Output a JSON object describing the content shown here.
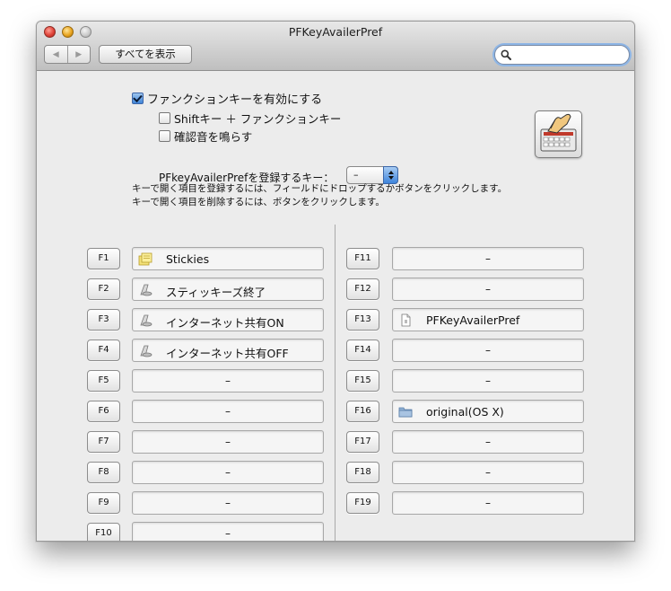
{
  "window": {
    "title": "PFKeyAvailerPref"
  },
  "toolbar": {
    "show_all_label": "すべてを表示",
    "search_placeholder": ""
  },
  "options": {
    "enable_fn_label": "ファンクションキーを有効にする",
    "enable_fn_checked": true,
    "shift_fn_label": "Shiftキー ＋ ファンクションキー",
    "shift_fn_checked": false,
    "beep_label": "確認音を鳴らす",
    "beep_checked": false,
    "register_key_label": "PFkeyAvailerPrefを登録するキー：",
    "register_key_value": "–"
  },
  "instructions": {
    "line1": "キーで開く項目を登録するには、フィールドにドロップするかボタンをクリックします。",
    "line2": "キーで開く項目を削除するには、ボタンをクリックします。"
  },
  "keys_left": [
    {
      "key": "F1",
      "item": "Stickies",
      "icon": "stickies-icon"
    },
    {
      "key": "F2",
      "item": "スティッキーズ終了",
      "icon": "script-icon"
    },
    {
      "key": "F3",
      "item": "インターネット共有ON",
      "icon": "script-icon"
    },
    {
      "key": "F4",
      "item": "インターネット共有OFF",
      "icon": "script-icon"
    },
    {
      "key": "F5",
      "item": "–",
      "icon": ""
    },
    {
      "key": "F6",
      "item": "–",
      "icon": ""
    },
    {
      "key": "F7",
      "item": "–",
      "icon": ""
    },
    {
      "key": "F8",
      "item": "–",
      "icon": ""
    },
    {
      "key": "F9",
      "item": "–",
      "icon": ""
    },
    {
      "key": "F10",
      "item": "–",
      "icon": ""
    }
  ],
  "keys_right": [
    {
      "key": "F11",
      "item": "–",
      "icon": ""
    },
    {
      "key": "F12",
      "item": "–",
      "icon": ""
    },
    {
      "key": "F13",
      "item": "PFKeyAvailerPref",
      "icon": "document-icon"
    },
    {
      "key": "F14",
      "item": "–",
      "icon": ""
    },
    {
      "key": "F15",
      "item": "–",
      "icon": ""
    },
    {
      "key": "F16",
      "item": "original(OS X)",
      "icon": "folder-icon"
    },
    {
      "key": "F17",
      "item": "–",
      "icon": ""
    },
    {
      "key": "F18",
      "item": "–",
      "icon": ""
    },
    {
      "key": "F19",
      "item": "–",
      "icon": ""
    }
  ]
}
